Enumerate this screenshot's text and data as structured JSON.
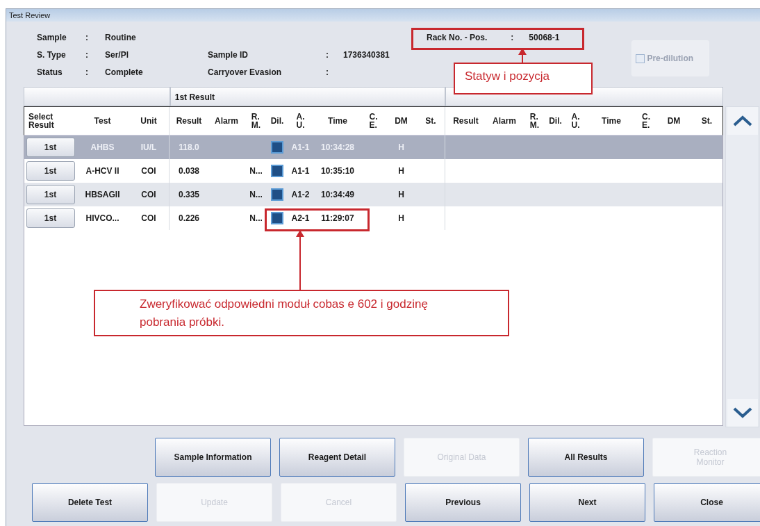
{
  "window": {
    "title": "Test Review"
  },
  "info": [
    {
      "label": "Sample",
      "colon": ":",
      "value": "Routine"
    },
    {
      "label": "S. Type",
      "colon": ":",
      "value": "Ser/Pl",
      "label2": "Sample ID",
      "colon2": ":",
      "value2": "1736340381"
    },
    {
      "label": "Status",
      "colon": ":",
      "value": "Complete",
      "label2": "Carryover Evasion",
      "colon2": ":"
    }
  ],
  "rack": {
    "label": "Rack No. - Pos.",
    "colon": ":",
    "value": "50068-1"
  },
  "pre_dilution": {
    "label": "Pre-dilution",
    "checked": false,
    "disabled": true
  },
  "table": {
    "group_1": "1st Result",
    "columns_left": [
      "Select\nResult",
      "Test",
      "Unit"
    ],
    "columns_first": [
      "Result",
      "Alarm",
      "R.\nM.",
      "Dil.",
      "A.\nU.",
      "Time",
      "C.\nE.",
      "DM",
      "St."
    ],
    "columns_rerun": [
      "Result",
      "Alarm",
      "R.\nM.",
      "Dil.",
      "A.\nU.",
      "Time",
      "C.\nE.",
      "DM",
      "St."
    ],
    "rows": [
      {
        "select": "1st",
        "test": "AHBS",
        "unit": "IU/L",
        "result": "118.0",
        "au": "A1-1",
        "time": "10:34:28",
        "dm": "H",
        "selected": true
      },
      {
        "select": "1st",
        "test": "A-HCV II",
        "unit": "COI",
        "result": "0.038",
        "rm": "N...",
        "au": "A1-1",
        "time": "10:35:10",
        "dm": "H",
        "selected": false
      },
      {
        "select": "1st",
        "test": "HBSAGII",
        "unit": "COI",
        "result": "0.335",
        "rm": "N...",
        "au": "A1-2",
        "time": "10:34:49",
        "dm": "H",
        "selected": false
      },
      {
        "select": "1st",
        "test": "HIVCO...",
        "unit": "COI",
        "result": "0.226",
        "rm": "N...",
        "au": "A2-1",
        "time": "11:29:07",
        "dm": "H",
        "selected": false
      }
    ]
  },
  "buttons_top": [
    {
      "label": "Sample Information",
      "disabled": false
    },
    {
      "label": "Reagent Detail",
      "disabled": false
    },
    {
      "label": "Original Data",
      "disabled": true
    },
    {
      "label": "All Results",
      "disabled": false
    },
    {
      "label": "Reaction\nMonitor",
      "disabled": true
    }
  ],
  "buttons_bottom": [
    {
      "label": "Delete Test",
      "disabled": false
    },
    {
      "label": "Update",
      "disabled": true
    },
    {
      "label": "Cancel",
      "disabled": true
    },
    {
      "label": "Previous",
      "disabled": false
    },
    {
      "label": "Next",
      "disabled": false
    },
    {
      "label": "Close",
      "disabled": false
    }
  ],
  "annotations": [
    {
      "text": "Statyw i pozycja"
    },
    {
      "text": "Zweryfikować odpowiedni moduł cobas e 602 i godzinę pobrania próbki."
    }
  ]
}
